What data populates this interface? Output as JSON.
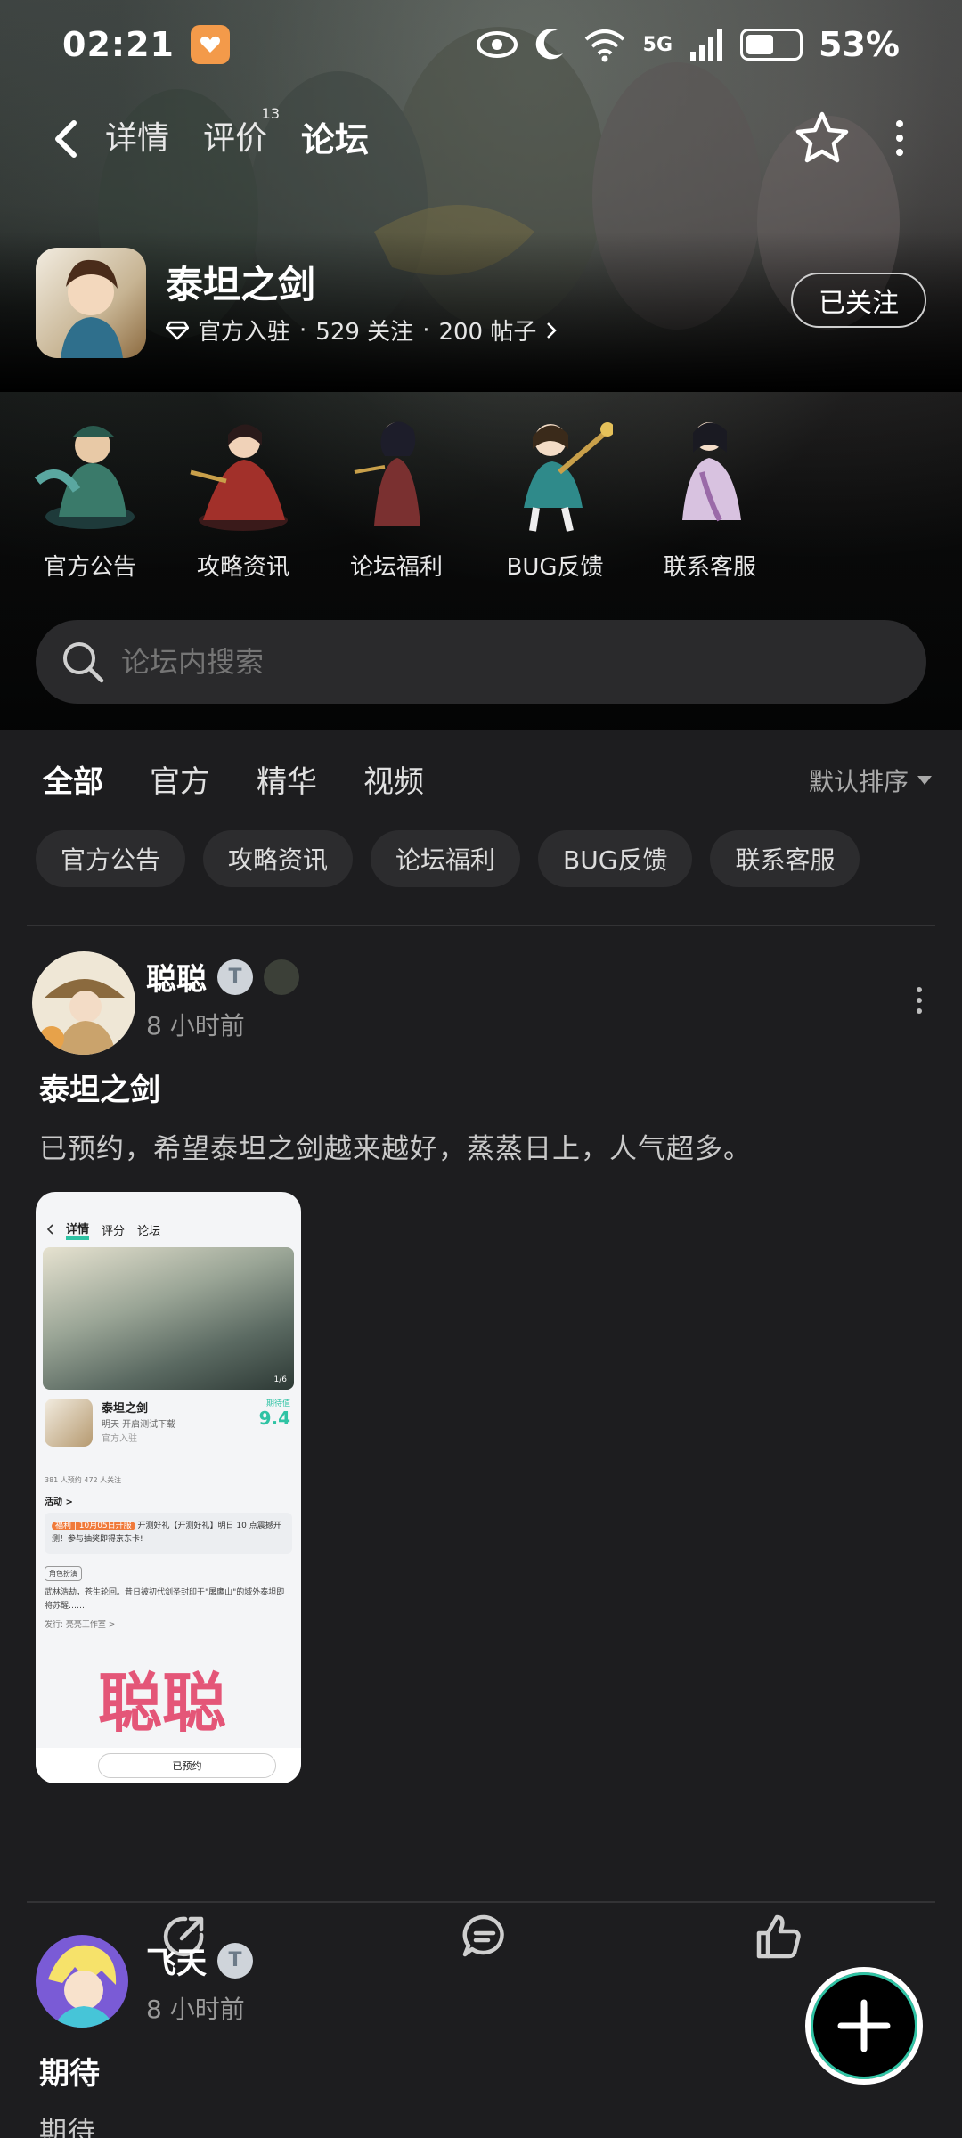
{
  "status_bar": {
    "time": "02:21",
    "network": "5G",
    "battery_level": 0.53,
    "battery_text": "53%"
  },
  "nav": {
    "tabs": [
      {
        "label": "详情",
        "badge": ""
      },
      {
        "label": "评价",
        "badge": "13"
      },
      {
        "label": "论坛",
        "badge": ""
      }
    ],
    "active_tab": "论坛"
  },
  "game": {
    "name": "泰坦之剑",
    "official_label": "官方入驻",
    "followers": "529 关注",
    "posts": "200 帖子",
    "follow_button": "已关注"
  },
  "categories": [
    {
      "label": "官方公告",
      "icon": "character-official-icon"
    },
    {
      "label": "攻略资讯",
      "icon": "character-guide-icon"
    },
    {
      "label": "论坛福利",
      "icon": "character-welfare-icon"
    },
    {
      "label": "BUG反馈",
      "icon": "character-bug-icon"
    },
    {
      "label": "联系客服",
      "icon": "character-service-icon"
    }
  ],
  "search": {
    "placeholder": "论坛内搜索"
  },
  "filter": {
    "tabs": [
      "全部",
      "官方",
      "精华",
      "视频"
    ],
    "active": "全部",
    "sort_label": "默认排序"
  },
  "chips": [
    "官方公告",
    "攻略资讯",
    "论坛福利",
    "BUG反馈",
    "联系客服"
  ],
  "posts": [
    {
      "author": "聪聪",
      "level": "T",
      "time": "8 小时前",
      "title": "泰坦之剑",
      "body": "已预约，希望泰坦之剑越来越好，蒸蒸日上，人气超多。",
      "image": {
        "nav_tabs": [
          "详情",
          "评分",
          "论坛"
        ],
        "game_name": "泰坦之剑",
        "sub": "明天 开启测试下载",
        "official": "官方入驻",
        "score_label": "期待值",
        "score": "9.4",
        "counts": "381 人预约   472 人关注",
        "activity": "活动 >",
        "promo_tag": "福利 | 10月05日开服",
        "promo_text": "开测好礼【开测好礼】明日 10 点震撼开测！参与抽奖即得京东卡!",
        "desc_tag": "角色扮演",
        "desc": "武林浩劫，苍生轮回。昔日被初代剑圣封印于\"屠鹰山\"的域外泰坦即将苏醒……",
        "studio": "发行: 亮亮工作室 >",
        "reserved": "已预约",
        "watermark": "聪聪",
        "page_indicator": "1/6"
      }
    },
    {
      "author": "飞天",
      "level": "T",
      "time": "8 小时前",
      "title": "期待",
      "body": "期待"
    }
  ],
  "colors": {
    "accent": "#2fc3a4",
    "background": "#1d1d1f",
    "chip_bg": "#2c2c2e"
  }
}
